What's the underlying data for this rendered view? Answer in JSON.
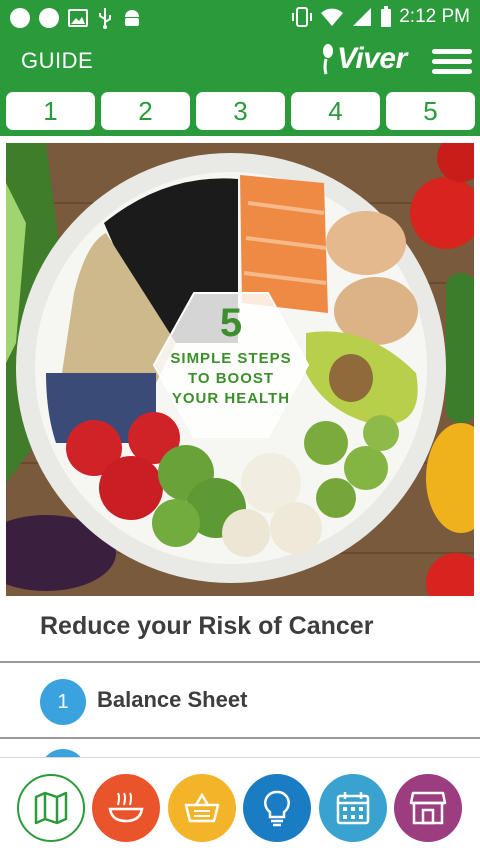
{
  "status_bar": {
    "time": "2:12 PM"
  },
  "header": {
    "title": "GUIDE",
    "logo_text": "Viver",
    "menu_icon": "hamburger-menu-icon"
  },
  "steps": [
    "1",
    "2",
    "3",
    "4",
    "5"
  ],
  "hero": {
    "badge_number": "5",
    "badge_lines": [
      "SIMPLE STEPS",
      "TO BOOST",
      "YOUR HEALTH"
    ]
  },
  "section": {
    "title": "Reduce your Risk of Cancer",
    "items": [
      {
        "number": "1",
        "label": "Balance Sheet"
      }
    ]
  },
  "bottom_nav": [
    {
      "name": "map",
      "icon": "map-icon",
      "color": "#ffffff"
    },
    {
      "name": "meals",
      "icon": "food-bowl-icon",
      "color": "#e9542a"
    },
    {
      "name": "shopping",
      "icon": "basket-icon",
      "color": "#f3b42a"
    },
    {
      "name": "tips",
      "icon": "lightbulb-icon",
      "color": "#1a7cc2"
    },
    {
      "name": "calendar",
      "icon": "calendar-icon",
      "color": "#3aa2cf"
    },
    {
      "name": "store",
      "icon": "store-icon",
      "color": "#9b3d7f"
    }
  ],
  "colors": {
    "brand_green": "#2b9a3b",
    "badge_blue": "#3aa2df"
  }
}
